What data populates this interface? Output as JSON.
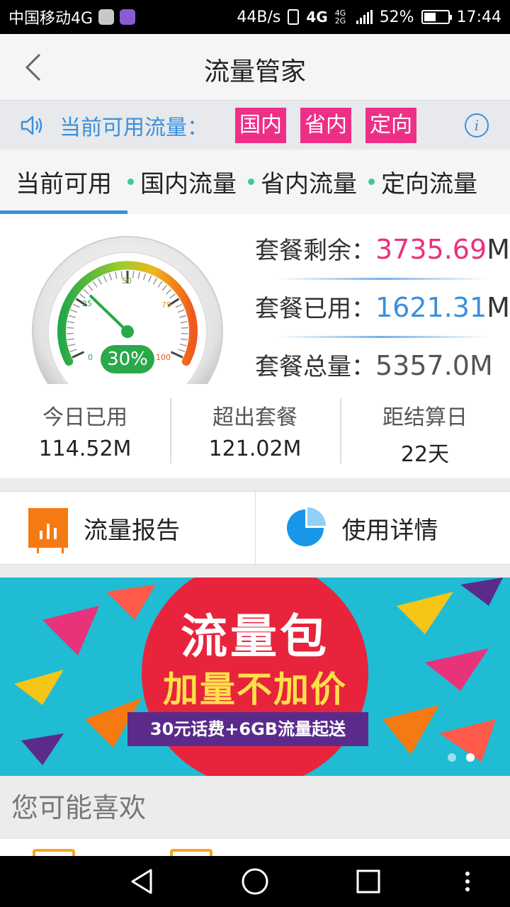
{
  "status_bar": {
    "carrier": "中国移动4G",
    "net_speed": "44B/s",
    "net_type": "4G",
    "net_type_small": "4G 2G",
    "battery": "52%",
    "battery_level": 0.52,
    "time": "17:44"
  },
  "header": {
    "title": "流量管家",
    "back_icon": "chevron-left-icon"
  },
  "notice": {
    "label": "当前可用流量：",
    "tags": [
      "国内",
      "省内",
      "定向"
    ],
    "info_icon": "i"
  },
  "tabs": [
    {
      "label": "当前可用",
      "active": true,
      "dot": false
    },
    {
      "label": "国内流量",
      "active": false,
      "dot": true
    },
    {
      "label": "省内流量",
      "active": false,
      "dot": true
    },
    {
      "label": "定向流量",
      "active": false,
      "dot": true
    }
  ],
  "gauge": {
    "percent_label": "30%",
    "percent_value": 0.3,
    "ticks": [
      "0",
      "25",
      "50",
      "75",
      "100"
    ]
  },
  "plan": {
    "remaining_label": "套餐剩余：",
    "remaining_value": "3735.69",
    "remaining_unit": "M",
    "used_label": "套餐已用：",
    "used_value": "1621.31",
    "used_unit": "M",
    "total_label": "套餐总量：",
    "total_value": "5357.0M"
  },
  "summary": [
    {
      "label": "今日已用",
      "value": "114.52M"
    },
    {
      "label": "超出套餐",
      "value": "121.02M"
    },
    {
      "label": "距结算日",
      "value": "22天"
    }
  ],
  "actions": [
    {
      "label": "流量报告",
      "icon": "bar-chart-icon"
    },
    {
      "label": "使用详情",
      "icon": "pie-chart-icon"
    }
  ],
  "banner": {
    "title": "流量包",
    "subtitle": "加量不加价",
    "ribbon": "30元话费+6GB流量起送",
    "slide_count": 2,
    "active_slide": 2
  },
  "recommend": {
    "title": "您可能喜欢"
  },
  "colors": {
    "accent_blue": "#3c8fdc",
    "tag_pink": "#ee2f87",
    "remaining_pink": "#e8327a",
    "used_blue": "#3c8fdc",
    "gauge_green": "#2aa84a",
    "report_orange": "#f57a12",
    "pie_blue": "#1a96e8",
    "banner_cyan": "#1fbcd4"
  }
}
